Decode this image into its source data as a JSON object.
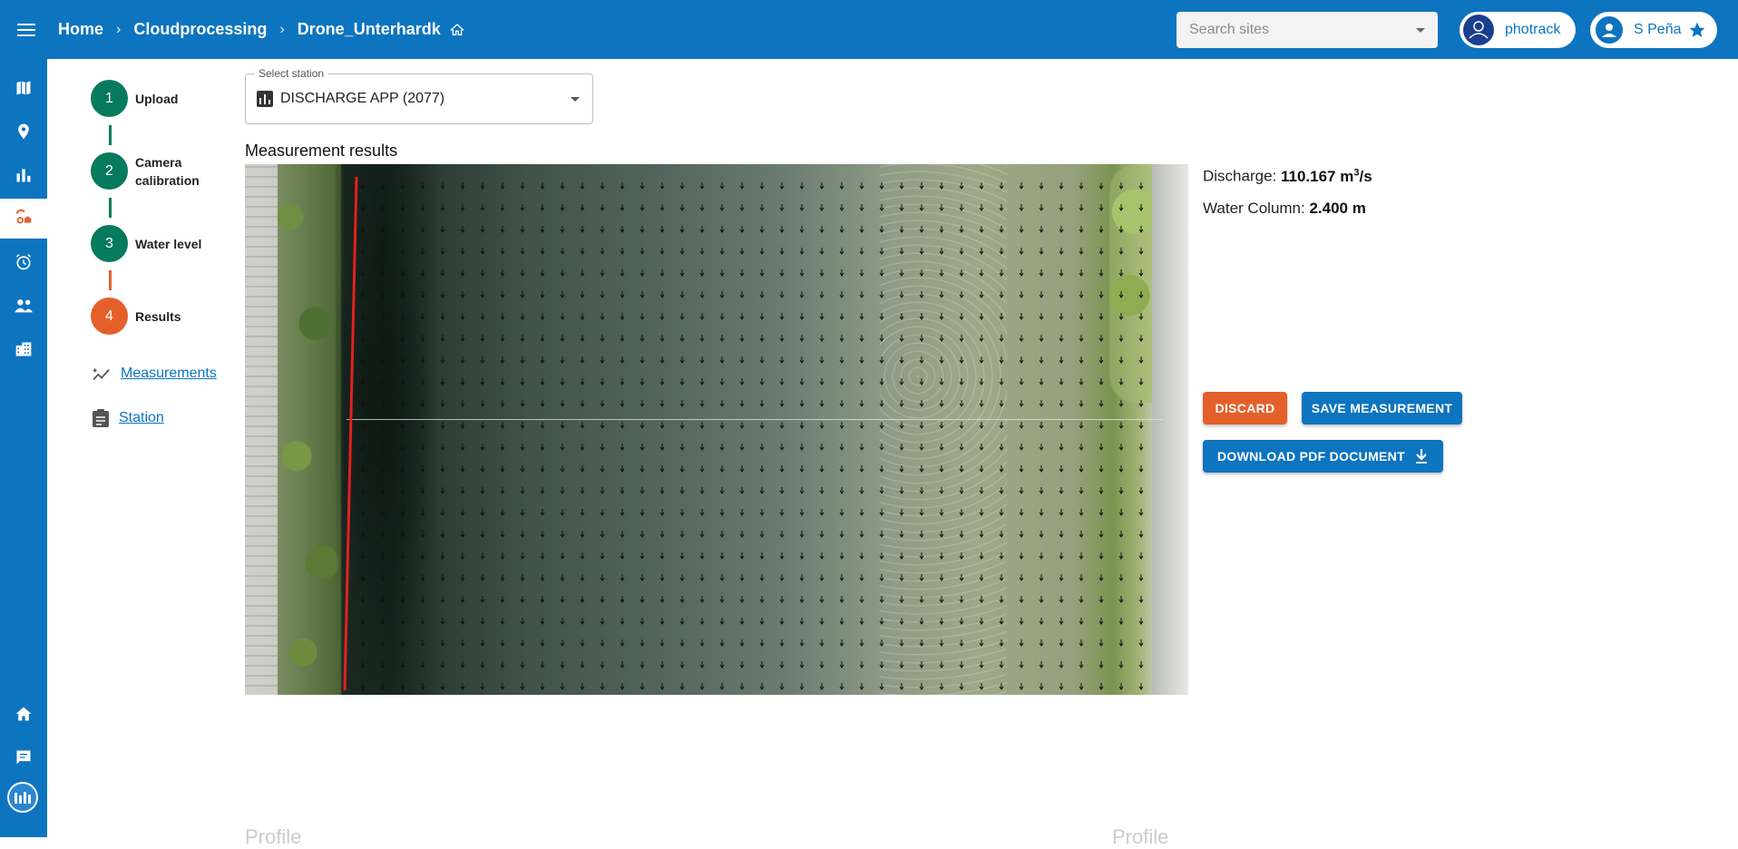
{
  "header": {
    "breadcrumb": [
      "Home",
      "Cloudprocessing",
      "Drone_Unterhardk"
    ],
    "search_placeholder": "Search sites",
    "org_name": "photrack",
    "user_name": "S Peña"
  },
  "colors": {
    "primary": "#0d74bf",
    "step_done": "#067a5e",
    "step_current": "#e3602b",
    "discard": "#e3602b"
  },
  "rail": {
    "icons": [
      "map-icon",
      "location-pin-icon",
      "bar-chart-icon",
      "cloud-processing-icon",
      "alarm-icon",
      "people-icon",
      "building-icon",
      "home-icon",
      "chat-icon",
      "app-logo-icon"
    ],
    "active": "cloud-processing-icon"
  },
  "stepper": {
    "steps": [
      {
        "number": "1",
        "label": "Upload"
      },
      {
        "number": "2",
        "label": "Camera calibration"
      },
      {
        "number": "3",
        "label": "Water level"
      },
      {
        "number": "4",
        "label": "Results"
      }
    ],
    "current_step": 4
  },
  "side_links": {
    "measurements": "Measurements",
    "station": "Station"
  },
  "station_select": {
    "legend": "Select station",
    "value": "DISCHARGE APP (2077)"
  },
  "results": {
    "title": "Measurement results",
    "discharge_label": "Discharge:",
    "discharge_value": "110.167 m",
    "discharge_unit_sup": "3",
    "discharge_unit_tail": "/s",
    "water_column_label": "Water Column:",
    "water_column_value": "2.400 m"
  },
  "buttons": {
    "discard": "DISCARD",
    "save": "SAVE MEASUREMENT",
    "download_pdf": "DOWNLOAD PDF DOCUMENT"
  },
  "bottom_headings": [
    "Profile",
    "Profile"
  ]
}
